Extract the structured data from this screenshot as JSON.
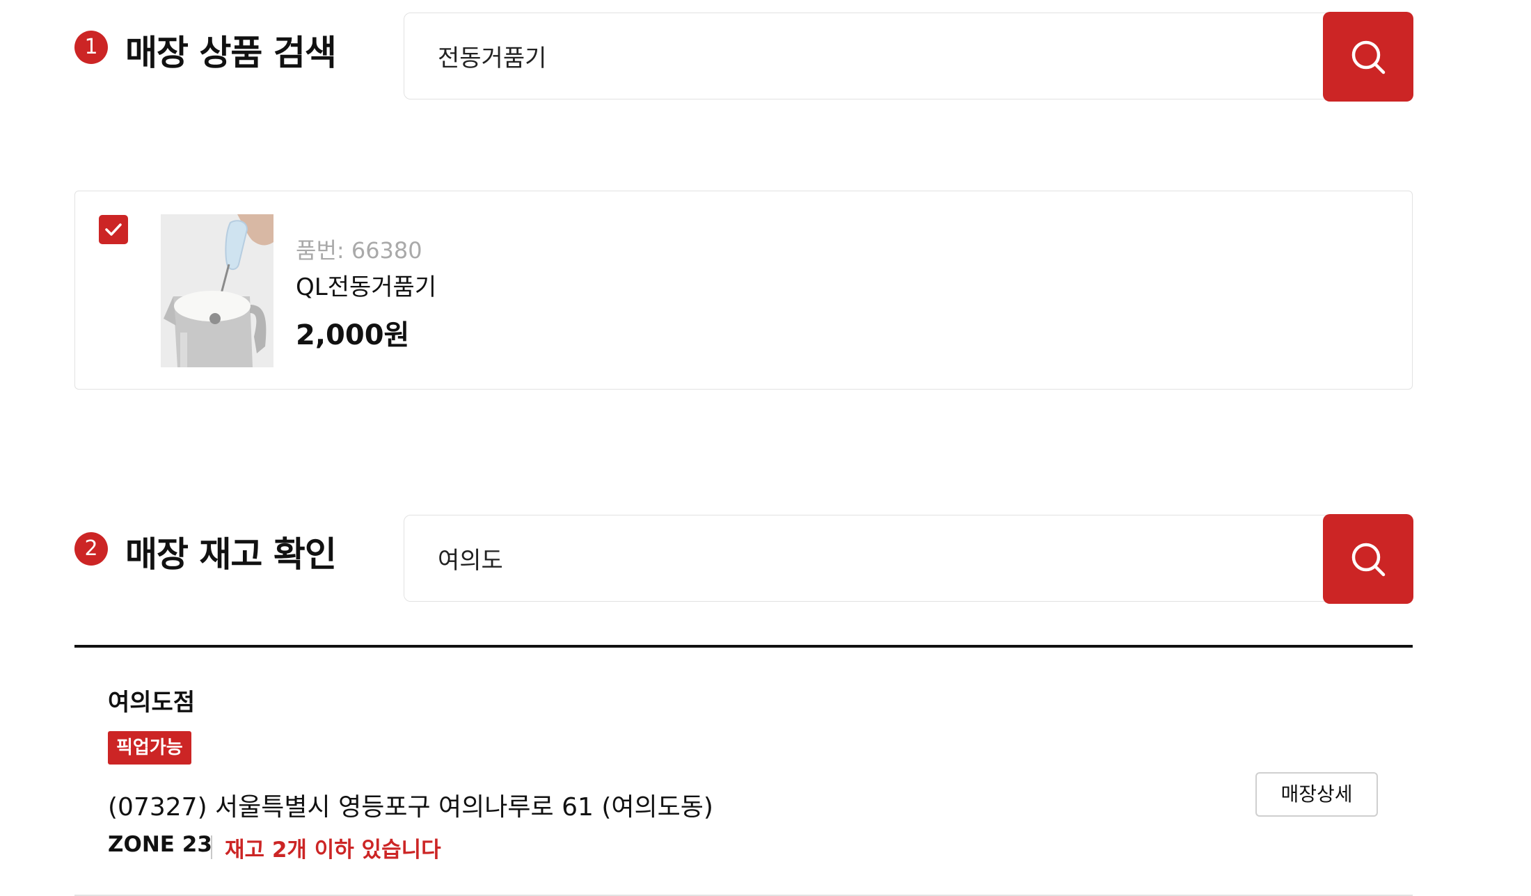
{
  "product_search": {
    "step_number": "1",
    "title": "매장 상품 검색",
    "query": "전동거품기",
    "search_icon": "search-icon"
  },
  "product": {
    "checked": true,
    "code_label": "품번: 66380",
    "name": "QL전동거품기",
    "price": "2,000원"
  },
  "stock_check": {
    "step_number": "2",
    "title": "매장 재고 확인",
    "query": "여의도",
    "search_icon": "search-icon"
  },
  "results": [
    {
      "store_name": "여의도점",
      "badge": "픽업가능",
      "address": "(07327) 서울특별시 영등포구 여의나루로 61 (여의도동)",
      "zone": "ZONE 23",
      "stock_note": "재고 2개 이하 있습니다",
      "detail_button": "매장상세"
    }
  ],
  "colors": {
    "accent": "#cc2525",
    "border": "#e2e2e2",
    "muted_text": "#a9a9a9",
    "text": "#111111"
  }
}
